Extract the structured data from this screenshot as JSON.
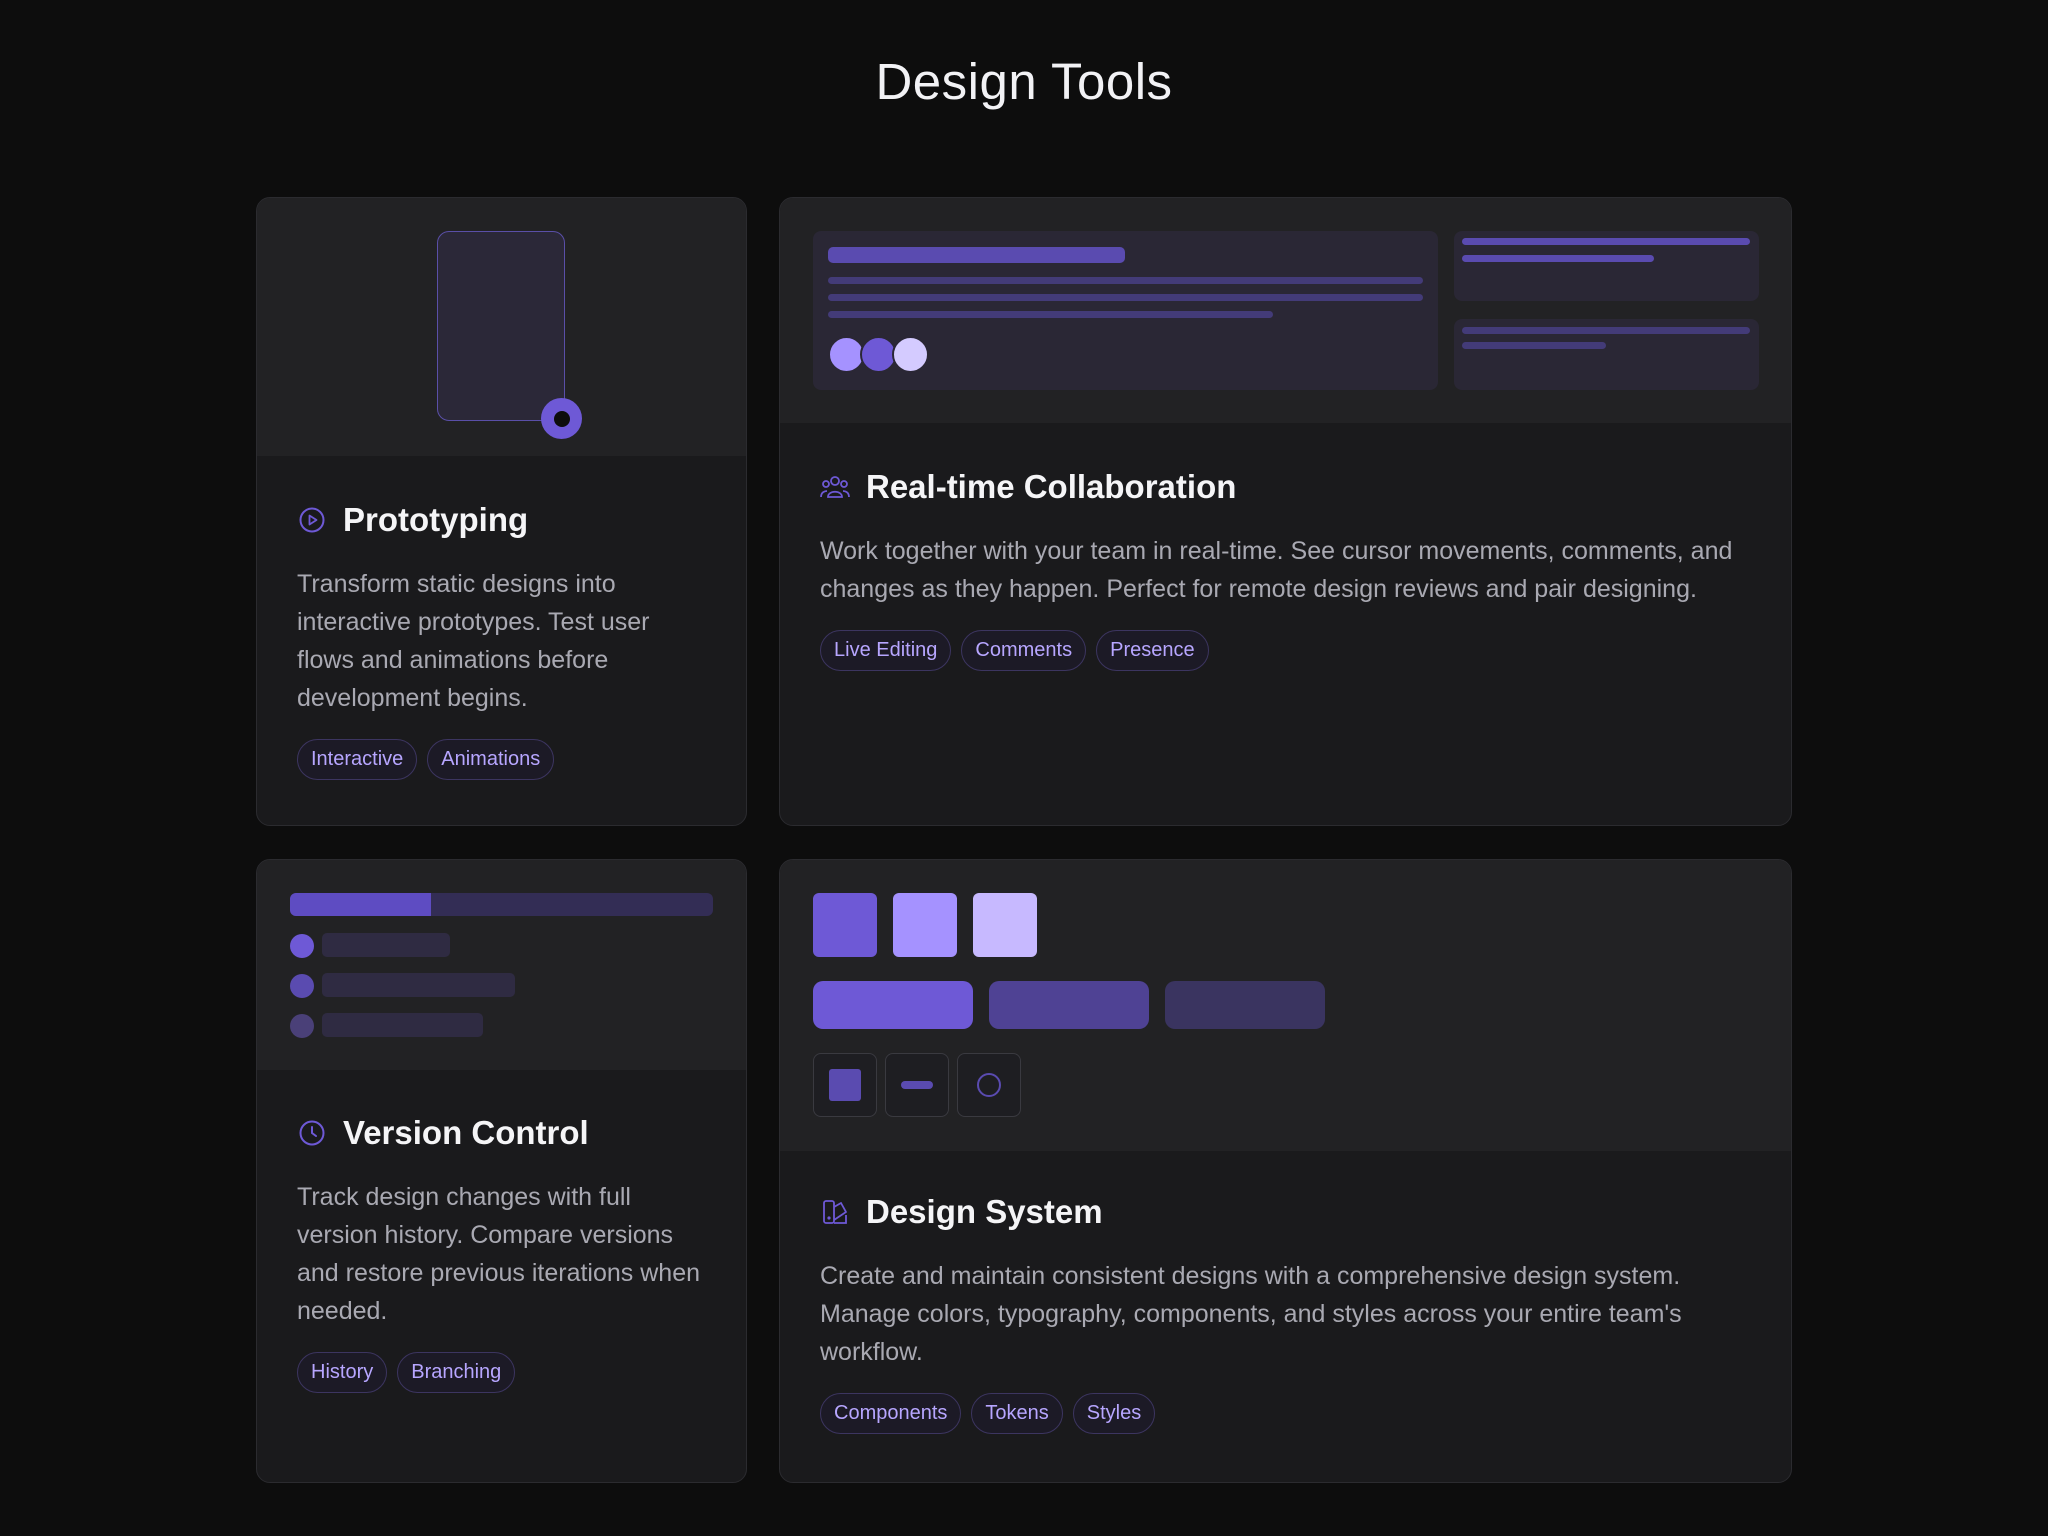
{
  "page": {
    "title": "Design Tools"
  },
  "colors": {
    "accent": "#6e59d6",
    "accent_light": "#a592ff",
    "accent_lighter": "#c7b9ff",
    "card_bg": "#1a1a1c",
    "page_bg": "#0d0d0d",
    "tag_text": "#b7a6ff"
  },
  "cards": [
    {
      "icon": "play-circle-icon",
      "title": "Prototyping",
      "description": "Transform static designs into interactive prototypes. Test user flows and animations before development begins.",
      "tags": [
        "Interactive",
        "Animations"
      ]
    },
    {
      "icon": "users-icon",
      "title": "Real-time Collaboration",
      "description": "Work together with your team in real-time. See cursor movements, comments, and changes as they happen. Perfect for remote design reviews and pair designing.",
      "tags": [
        "Live Editing",
        "Comments",
        "Presence"
      ]
    },
    {
      "icon": "clock-icon",
      "title": "Version Control",
      "description": "Track design changes with full version history. Compare versions and restore previous iterations when needed.",
      "tags": [
        "History",
        "Branching"
      ]
    },
    {
      "icon": "palette-icon",
      "title": "Design System",
      "description": "Create and maintain consistent designs with a comprehensive design system. Manage colors, typography, components, and styles across your entire team's workflow.",
      "tags": [
        "Components",
        "Tokens",
        "Styles"
      ]
    }
  ]
}
